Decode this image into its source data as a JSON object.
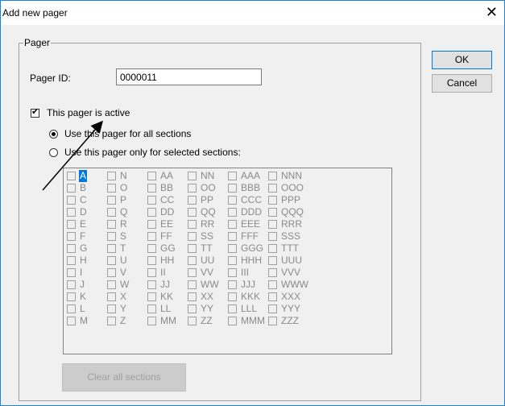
{
  "window": {
    "title": "Add new pager",
    "close_glyph": "✕"
  },
  "group": {
    "label": "Pager"
  },
  "pager_id": {
    "label": "Pager ID:",
    "value": "0000011"
  },
  "active": {
    "label": "This pager is active",
    "checked": true
  },
  "radio_all": {
    "label": "Use this pager for all sections",
    "selected": true
  },
  "radio_selected": {
    "label": "Use this pager only for selected sections:",
    "selected": false
  },
  "buttons": {
    "ok": "OK",
    "cancel": "Cancel",
    "clear": "Clear all sections"
  },
  "sections": {
    "columns": [
      [
        "A",
        "B",
        "C",
        "D",
        "E",
        "F",
        "G",
        "H",
        "I",
        "J",
        "K",
        "L",
        "M"
      ],
      [
        "N",
        "O",
        "P",
        "Q",
        "R",
        "S",
        "T",
        "U",
        "V",
        "W",
        "X",
        "Y",
        "Z"
      ],
      [
        "AA",
        "BB",
        "CC",
        "DD",
        "EE",
        "FF",
        "GG",
        "HH",
        "II",
        "JJ",
        "KK",
        "LL",
        "MM"
      ],
      [
        "NN",
        "OO",
        "PP",
        "QQ",
        "RR",
        "SS",
        "TT",
        "UU",
        "VV",
        "WW",
        "XX",
        "YY",
        "ZZ"
      ],
      [
        "AAA",
        "BBB",
        "CCC",
        "DDD",
        "EEE",
        "FFF",
        "GGG",
        "HHH",
        "III",
        "JJJ",
        "KKK",
        "LLL",
        "MMM"
      ],
      [
        "NNN",
        "OOO",
        "PPP",
        "QQQ",
        "RRR",
        "SSS",
        "TTT",
        "UUU",
        "VVV",
        "WWW",
        "XXX",
        "YYY",
        "ZZZ"
      ]
    ],
    "highlighted": "A"
  }
}
